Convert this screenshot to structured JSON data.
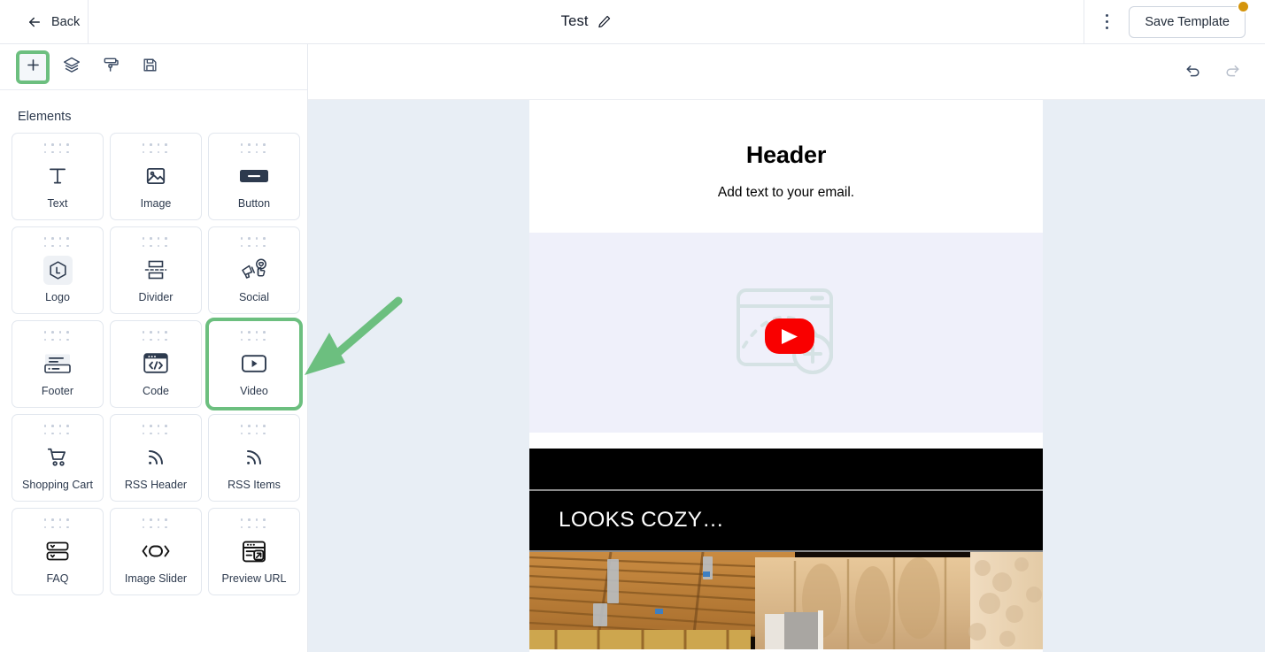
{
  "topbar": {
    "back_label": "Back",
    "back_icon": "arrow-left-icon",
    "doc_title": "Test",
    "edit_icon": "pencil-icon",
    "menu_icon": "kebab-menu-icon",
    "save_label": "Save Template",
    "badge_color": "#d4940b"
  },
  "panel": {
    "title": "Elements",
    "toolbar": [
      {
        "name": "add-element-tool",
        "icon": "plus-icon",
        "active": true
      },
      {
        "name": "layers-tool",
        "icon": "layers-icon",
        "active": false
      },
      {
        "name": "style-tool",
        "icon": "paint-roller-icon",
        "active": false
      },
      {
        "name": "save-tool",
        "icon": "floppy-disk-icon",
        "active": false
      }
    ],
    "elements": [
      {
        "label": "Text",
        "icon": "text-icon",
        "selected": false
      },
      {
        "label": "Image",
        "icon": "image-icon",
        "selected": false
      },
      {
        "label": "Button",
        "icon": "button-icon",
        "selected": false
      },
      {
        "label": "Logo",
        "icon": "logo-hexagon-icon",
        "selected": false
      },
      {
        "label": "Divider",
        "icon": "divider-icon",
        "selected": false
      },
      {
        "label": "Social",
        "icon": "social-megaphone-icon",
        "selected": false
      },
      {
        "label": "Footer",
        "icon": "footer-icon",
        "selected": false
      },
      {
        "label": "Code",
        "icon": "code-window-icon",
        "selected": false
      },
      {
        "label": "Video",
        "icon": "video-play-icon",
        "selected": true
      },
      {
        "label": "Shopping Cart",
        "icon": "shopping-cart-icon",
        "selected": false
      },
      {
        "label": "RSS Header",
        "icon": "rss-icon",
        "selected": false
      },
      {
        "label": "RSS Items",
        "icon": "rss-icon",
        "selected": false
      },
      {
        "label": "FAQ",
        "icon": "faq-accordion-icon",
        "selected": false
      },
      {
        "label": "Image Slider",
        "icon": "image-slider-icon",
        "selected": false
      },
      {
        "label": "Preview URL",
        "icon": "preview-url-icon",
        "selected": false
      }
    ]
  },
  "canvas": {
    "undo_icon": "undo-icon",
    "redo_icon": "redo-icon",
    "email": {
      "header": "Header",
      "subtext": "Add text to your email.",
      "video_placeholder_icon": "youtube-video-placeholder-icon",
      "video_caption": "LOOKS COZY…"
    }
  },
  "annotation": {
    "arrow_color": "#6cbf7f",
    "highlight_color": "#6cbf7f"
  }
}
